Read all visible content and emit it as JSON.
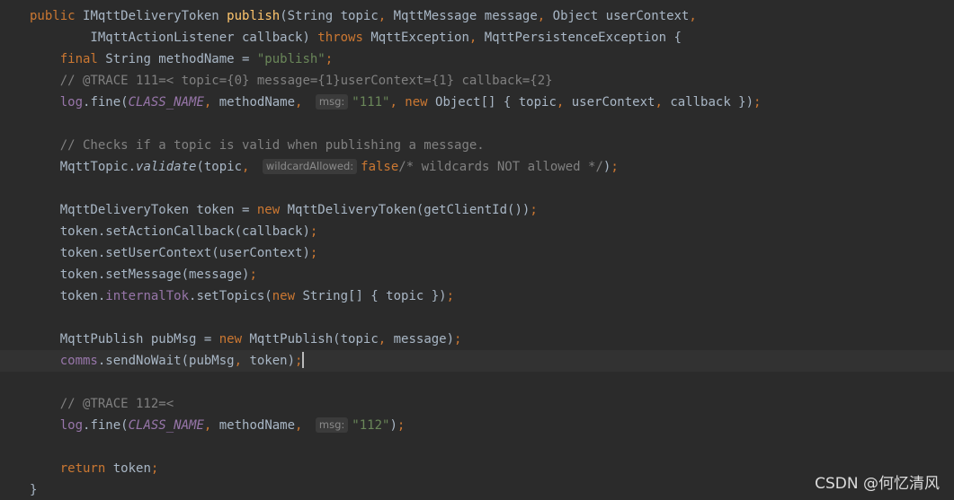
{
  "editor": {
    "lines": [
      {
        "tokens": [
          {
            "t": "public ",
            "c": "kw"
          },
          {
            "t": "IMqttDeliveryToken "
          },
          {
            "t": "publish",
            "c": "fn"
          },
          {
            "t": "(String topic"
          },
          {
            "t": ", ",
            "c": "kw"
          },
          {
            "t": "MqttMessage message"
          },
          {
            "t": ", ",
            "c": "kw"
          },
          {
            "t": "Object userContext"
          },
          {
            "t": ",",
            "c": "kw"
          }
        ]
      },
      {
        "tokens": [
          {
            "t": "        IMqttActionListener callback) "
          },
          {
            "t": "throws ",
            "c": "kw"
          },
          {
            "t": "MqttException"
          },
          {
            "t": ", ",
            "c": "kw"
          },
          {
            "t": "MqttPersistenceException {"
          }
        ]
      },
      {
        "tokens": [
          {
            "t": "    "
          },
          {
            "t": "final ",
            "c": "kw"
          },
          {
            "t": "String methodName = "
          },
          {
            "t": "\"publish\"",
            "c": "str"
          },
          {
            "t": ";",
            "c": "kw"
          }
        ]
      },
      {
        "tokens": [
          {
            "t": "    "
          },
          {
            "t": "// @TRACE 111=< topic={0} message={1}userContext={1} callback={2}",
            "c": "cmt"
          }
        ]
      },
      {
        "tokens": [
          {
            "t": "    "
          },
          {
            "t": "log",
            "c": "fld"
          },
          {
            "t": ".fine("
          },
          {
            "t": "CLASS_NAME",
            "c": "cst"
          },
          {
            "t": ", ",
            "c": "kw"
          },
          {
            "t": "methodName"
          },
          {
            "t": ", ",
            "c": "kw"
          },
          {
            "hint": "msg:"
          },
          {
            "t": "\"111\"",
            "c": "str"
          },
          {
            "t": ", ",
            "c": "kw"
          },
          {
            "t": "new ",
            "c": "kw"
          },
          {
            "t": "Object[] { topic"
          },
          {
            "t": ", ",
            "c": "kw"
          },
          {
            "t": "userContext"
          },
          {
            "t": ", ",
            "c": "kw"
          },
          {
            "t": "callback })"
          },
          {
            "t": ";",
            "c": "kw"
          }
        ]
      },
      {
        "tokens": []
      },
      {
        "tokens": [
          {
            "t": "    "
          },
          {
            "t": "// Checks if a topic is valid when publishing a message.",
            "c": "cmt"
          }
        ]
      },
      {
        "tokens": [
          {
            "t": "    "
          },
          {
            "t": "MqttTopic."
          },
          {
            "t": "validate",
            "c": "it"
          },
          {
            "t": "(topic"
          },
          {
            "t": ", ",
            "c": "kw"
          },
          {
            "hint": "wildcardAllowed:"
          },
          {
            "t": "false",
            "c": "kw"
          },
          {
            "t": "/* wildcards NOT allowed */",
            "c": "cmt"
          },
          {
            "t": ")"
          },
          {
            "t": ";",
            "c": "kw"
          }
        ]
      },
      {
        "tokens": []
      },
      {
        "tokens": [
          {
            "t": "    "
          },
          {
            "t": "MqttDeliveryToken token = "
          },
          {
            "t": "new ",
            "c": "kw"
          },
          {
            "t": "MqttDeliveryToken(getClientId())"
          },
          {
            "t": ";",
            "c": "kw"
          }
        ]
      },
      {
        "tokens": [
          {
            "t": "    "
          },
          {
            "t": "token.setActionCallback(callback)"
          },
          {
            "t": ";",
            "c": "kw"
          }
        ]
      },
      {
        "tokens": [
          {
            "t": "    "
          },
          {
            "t": "token.setUserContext(userContext)"
          },
          {
            "t": ";",
            "c": "kw"
          }
        ]
      },
      {
        "tokens": [
          {
            "t": "    "
          },
          {
            "t": "token.setMessage(message)"
          },
          {
            "t": ";",
            "c": "kw"
          }
        ]
      },
      {
        "tokens": [
          {
            "t": "    "
          },
          {
            "t": "token."
          },
          {
            "t": "internalTok",
            "c": "fld"
          },
          {
            "t": ".setTopics("
          },
          {
            "t": "new ",
            "c": "kw"
          },
          {
            "t": "String[] { topic })"
          },
          {
            "t": ";",
            "c": "kw"
          }
        ]
      },
      {
        "tokens": []
      },
      {
        "tokens": [
          {
            "t": "    "
          },
          {
            "t": "MqttPublish pubMsg = "
          },
          {
            "t": "new ",
            "c": "kw"
          },
          {
            "t": "MqttPublish(topic"
          },
          {
            "t": ", ",
            "c": "kw"
          },
          {
            "t": "message)"
          },
          {
            "t": ";",
            "c": "kw"
          }
        ]
      },
      {
        "current": true,
        "tokens": [
          {
            "t": "    "
          },
          {
            "t": "comms",
            "c": "fld"
          },
          {
            "t": ".sendNoWait(pubMsg"
          },
          {
            "t": ", ",
            "c": "kw"
          },
          {
            "t": "token)"
          },
          {
            "t": ";",
            "c": "kw"
          },
          {
            "caret": true
          }
        ]
      },
      {
        "tokens": []
      },
      {
        "tokens": [
          {
            "t": "    "
          },
          {
            "t": "// @TRACE 112=<",
            "c": "cmt"
          }
        ]
      },
      {
        "tokens": [
          {
            "t": "    "
          },
          {
            "t": "log",
            "c": "fld"
          },
          {
            "t": ".fine("
          },
          {
            "t": "CLASS_NAME",
            "c": "cst"
          },
          {
            "t": ", ",
            "c": "kw"
          },
          {
            "t": "methodName"
          },
          {
            "t": ", ",
            "c": "kw"
          },
          {
            "hint": "msg:"
          },
          {
            "t": "\"112\"",
            "c": "str"
          },
          {
            "t": ")"
          },
          {
            "t": ";",
            "c": "kw"
          }
        ]
      },
      {
        "tokens": []
      },
      {
        "tokens": [
          {
            "t": "    "
          },
          {
            "t": "return ",
            "c": "kw"
          },
          {
            "t": "token"
          },
          {
            "t": ";",
            "c": "kw"
          }
        ]
      },
      {
        "tokens": [
          {
            "t": "}"
          }
        ]
      }
    ]
  },
  "watermark": "CSDN @何忆清风",
  "colors": {
    "background": "#2b2b2b",
    "current_line": "#323232",
    "default_text": "#a9b7c6",
    "keyword": "#cc7832",
    "method_declaration": "#ffc66d",
    "string": "#6a8759",
    "comment": "#808080",
    "field": "#9876aa",
    "inlay_hint_bg": "#3b3b3b",
    "inlay_hint_text": "#8a8a8a"
  }
}
